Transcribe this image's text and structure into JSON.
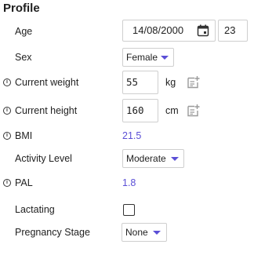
{
  "profile": {
    "title": "Profile",
    "age": {
      "label": "Age",
      "date": "14/08/2000",
      "years": "23"
    },
    "sex": {
      "label": "Sex",
      "value": "Female"
    },
    "weight": {
      "label": "Current weight",
      "value": "55",
      "unit": "kg"
    },
    "height": {
      "label": "Current height",
      "value": "160",
      "unit": "cm"
    },
    "bmi": {
      "label": "BMI",
      "value": "21.5"
    },
    "activity": {
      "label": "Activity Level",
      "value": "Moderate"
    },
    "pal": {
      "label": "PAL",
      "value": "1.8"
    },
    "lactating": {
      "label": "Lactating",
      "checked": false
    },
    "pregnancy": {
      "label": "Pregnancy Stage",
      "value": "None"
    }
  },
  "icons": {
    "info": "info-icon",
    "calendar": "calendar-icon",
    "note": "add-note-icon",
    "dropdown": "chevron-down-icon"
  },
  "colors": {
    "accent": "#5b4fd6"
  }
}
